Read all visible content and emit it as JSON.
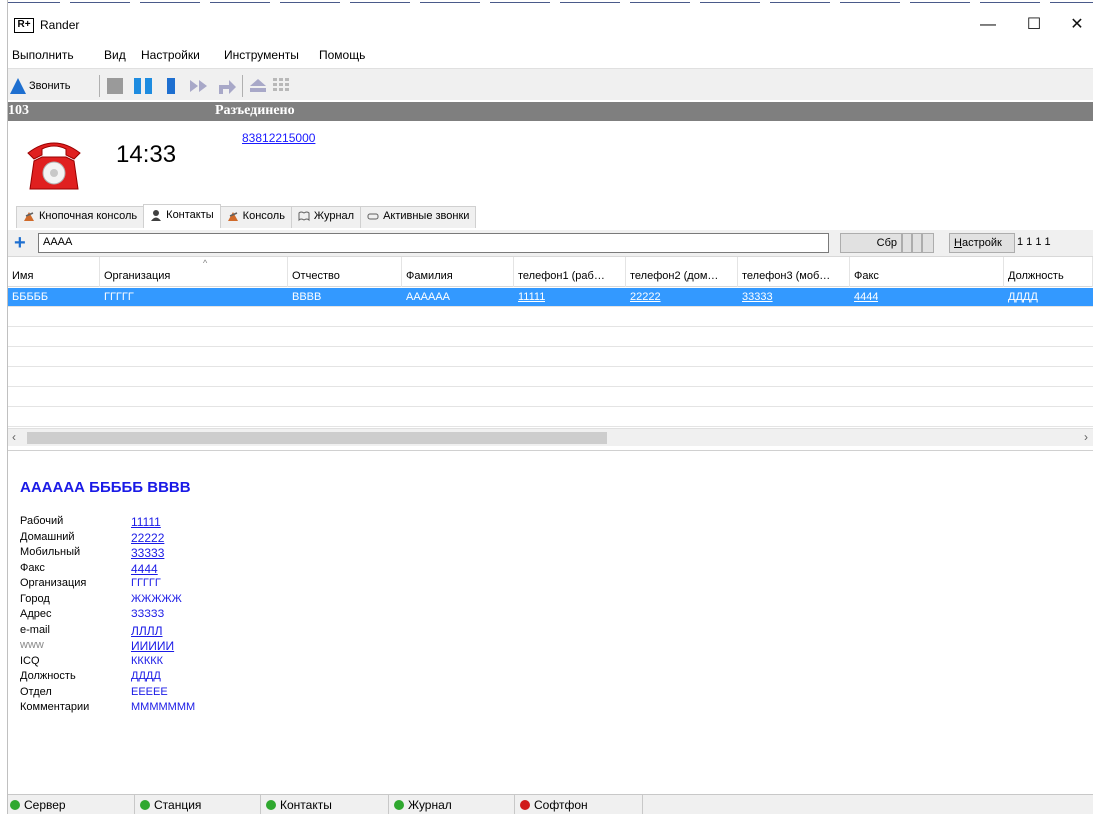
{
  "window": {
    "app_logo": "R+",
    "title": "Rander",
    "minimize": "—",
    "maximize": "☐",
    "close": "✕"
  },
  "menu": [
    "Выполнить",
    "Вид",
    "Настройки",
    "Инструменты",
    "Помощь"
  ],
  "toolbar": {
    "call_label": "Звонить",
    "icons": [
      "call-up-icon",
      "stop-icon",
      "pause-icon",
      "hold-icon",
      "forward-icon",
      "transfer-icon",
      "conference-icon",
      "dialpad-icon"
    ]
  },
  "line": {
    "number": "103",
    "status": "Разъединено",
    "time": "14:33",
    "phone": "83812215000"
  },
  "tabs": [
    {
      "label": "Кнопочная консоль",
      "icon": "button-console-icon"
    },
    {
      "label": "Контакты",
      "icon": "contacts-icon"
    },
    {
      "label": "Консоль",
      "icon": "console-icon"
    },
    {
      "label": "Журнал",
      "icon": "journal-icon"
    },
    {
      "label": "Активные звонки",
      "icon": "active-calls-icon"
    }
  ],
  "search": {
    "value": "АААА",
    "reset_label": "Сбр",
    "settings_label": "Настройк",
    "settings_mnemonic": "Н",
    "page_info": "1 1 1   1"
  },
  "grid": {
    "columns": [
      "Имя",
      "Организация",
      "Отчество",
      "Фамилия",
      "телефон1 (раб…",
      "телефон2 (дом…",
      "телефон3 (моб…",
      "Факс",
      "Должность"
    ],
    "rows": [
      [
        "БББББ",
        "ГГГГГ",
        "ВВВВ",
        "АААААА",
        "11111",
        "22222",
        "33333",
        "4444",
        "ДДДД"
      ]
    ]
  },
  "details": {
    "full_name": "АААААА БББББ ВВВВ",
    "fields": [
      {
        "label": "Рабочий",
        "value": "11111",
        "link": true
      },
      {
        "label": "Домашний",
        "value": "22222",
        "link": true
      },
      {
        "label": "Мобильный",
        "value": "33333",
        "link": true
      },
      {
        "label": "Факс",
        "value": "4444",
        "link": true
      },
      {
        "label": "Организация",
        "value": "ГГГГГ",
        "link": false
      },
      {
        "label": "Город",
        "value": "ЖЖЖЖЖ",
        "link": false
      },
      {
        "label": "Адрес",
        "value": "ЗЗЗЗЗ",
        "link": false
      },
      {
        "label": "e-mail",
        "value": "ЛЛЛЛ",
        "link": true
      },
      {
        "label": "www",
        "value": "ИИИИИ",
        "link": true
      },
      {
        "label": "ICQ",
        "value": "ККККК",
        "link": false
      },
      {
        "label": "Должность",
        "value": "ДДДД",
        "link": false
      },
      {
        "label": "Отдел",
        "value": "ЕЕЕЕЕ",
        "link": false
      },
      {
        "label": "Комментарии",
        "value": "МММММММ",
        "link": false
      }
    ]
  },
  "status": [
    {
      "label": "Сервер",
      "color": "#2fa82f"
    },
    {
      "label": "Станция",
      "color": "#2fa82f"
    },
    {
      "label": "Контакты",
      "color": "#2fa82f"
    },
    {
      "label": "Журнал",
      "color": "#2fa82f"
    },
    {
      "label": "Софтфон",
      "color": "#d01a1a"
    }
  ]
}
